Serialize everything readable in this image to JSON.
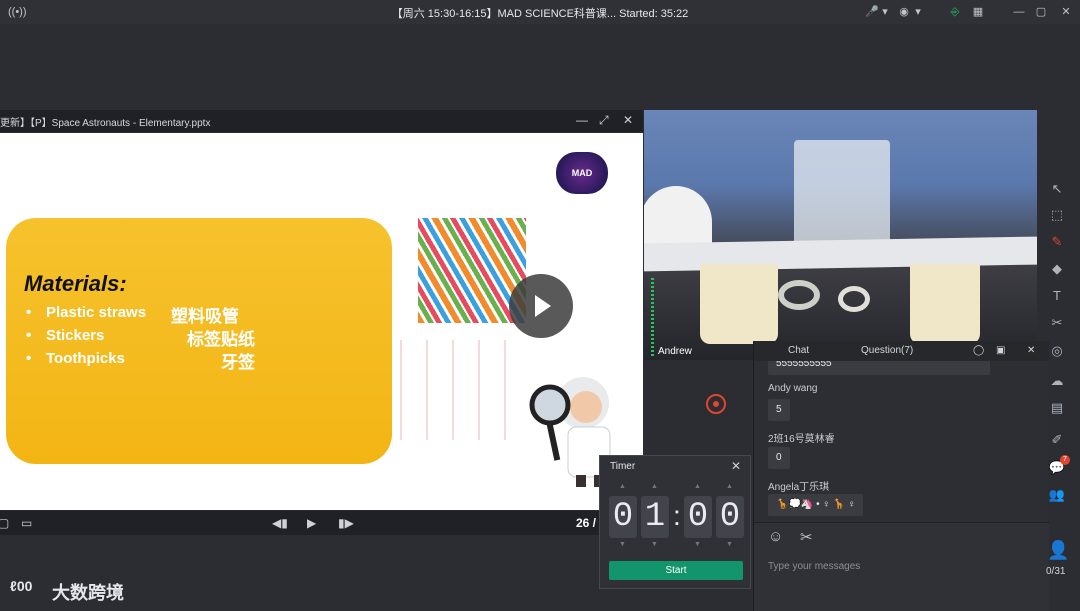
{
  "window": {
    "title": "【周六 15:30-16:15】MAD SCIENCE科普课...   Started: 35:22"
  },
  "ppt": {
    "header_title": "更新】【P】Space Astronauts - Elementary.pptx",
    "materials_title": "Materials:",
    "items": [
      {
        "en": "Plastic straws",
        "cn": "塑料吸管"
      },
      {
        "en": "Stickers",
        "cn": "标签贴纸"
      },
      {
        "en": "Toothpicks",
        "cn": "牙签"
      }
    ],
    "logo_text": "MAD SCIENCE",
    "page": "26 /"
  },
  "video": {
    "name": "Andrew"
  },
  "chat": {
    "tabs": {
      "chat": "Chat",
      "question": "Question(7)"
    },
    "messages": [
      {
        "name": "",
        "text": "5555555555"
      },
      {
        "name": "Andy wang",
        "text": "5"
      },
      {
        "name": "2班16号莫林睿",
        "text": "0"
      },
      {
        "name": "Angela丁乐琪",
        "text": "🦒💭🦄 • ♀ 🦒 ♀"
      }
    ],
    "placeholder": "Type your messages"
  },
  "timer": {
    "title": "Timer",
    "digits": [
      "0",
      "1",
      "0",
      "0"
    ],
    "start_label": "Start"
  },
  "sidebar": {
    "badge": "7",
    "user_count": "0/31"
  },
  "brand": {
    "name": "大数跨境",
    "icon_text": "ℓ00"
  }
}
